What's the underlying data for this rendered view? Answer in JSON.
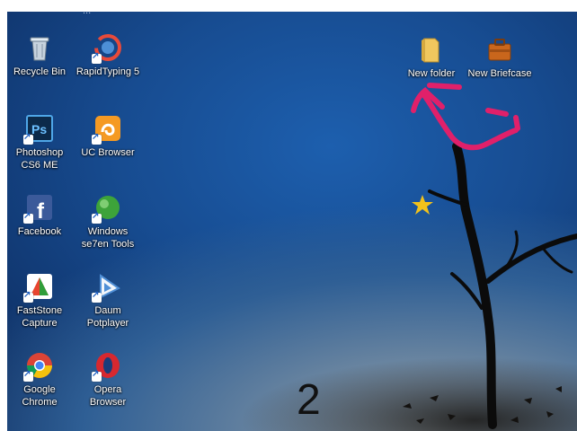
{
  "top_cut_text": "...",
  "desktop_icons": [
    {
      "label": "Recycle Bin",
      "icon": "recycle-bin-icon"
    },
    {
      "label": "RapidTyping 5",
      "icon": "rapidtyping-icon"
    },
    {
      "label": "Photoshop CS6 ME",
      "icon": "photoshop-icon"
    },
    {
      "label": "UC Browser",
      "icon": "uc-browser-icon"
    },
    {
      "label": "Facebook",
      "icon": "facebook-icon"
    },
    {
      "label": "Windows se7en Tools",
      "icon": "windows-seven-tools-icon"
    },
    {
      "label": "FastStone Capture",
      "icon": "faststone-icon"
    },
    {
      "label": "Daum Potplayer",
      "icon": "potplayer-icon"
    },
    {
      "label": "Google Chrome",
      "icon": "chrome-icon"
    },
    {
      "label": "Opera Browser",
      "icon": "opera-icon"
    },
    {
      "label": "New folder",
      "icon": "folder-icon"
    },
    {
      "label": "New Briefcase",
      "icon": "briefcase-icon"
    }
  ],
  "page_number": "2",
  "colors": {
    "annotation": "#e0206a",
    "star": "#f2c21b"
  }
}
